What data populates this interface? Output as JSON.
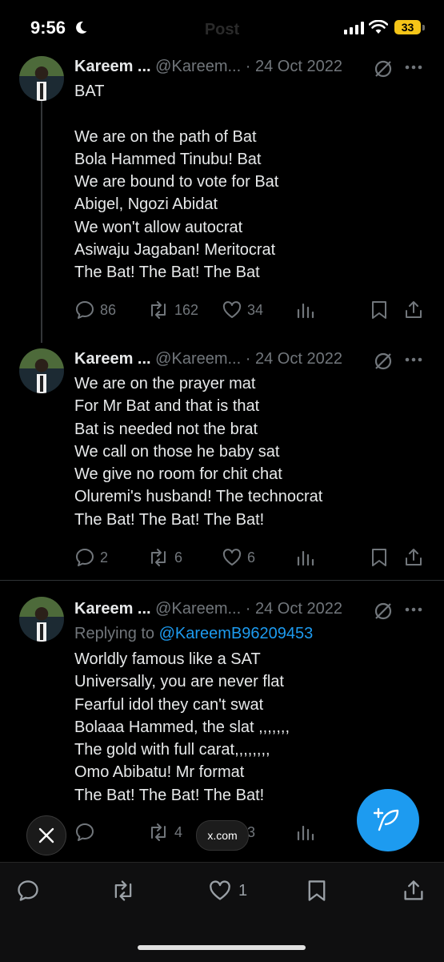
{
  "status_bar": {
    "time": "9:56",
    "battery": "33",
    "faded_title": "Post"
  },
  "tweets": [
    {
      "name": "Kareem ...",
      "handle": "@Kareem...",
      "sep": "·",
      "date": "24 Oct 2022",
      "body": "BAT\n\nWe are on the path of Bat\nBola Hammed Tinubu! Bat\nWe are bound to vote for Bat\nAbigel, Ngozi Abidat\nWe won't allow autocrat\nAsiwaju Jagaban! Meritocrat\nThe Bat! The Bat! The Bat",
      "replies": "86",
      "reposts": "162",
      "likes": "34"
    },
    {
      "name": "Kareem ...",
      "handle": "@Kareem...",
      "sep": "·",
      "date": "24 Oct 2022",
      "body": "We are on the prayer mat\nFor Mr Bat and that is that\nBat is needed not the brat\nWe call on those he baby sat\nWe give no room for chit chat\nOluremi's husband! The technocrat\nThe Bat! The Bat! The Bat!",
      "replies": "2",
      "reposts": "6",
      "likes": "6"
    },
    {
      "name": "Kareem ...",
      "handle": "@Kareem...",
      "sep": "·",
      "date": "24 Oct 2022",
      "reply_prefix": "Replying to ",
      "reply_mention": "@KareemB96209453",
      "body": "Worldly famous like a SAT\nUniversally, you are never flat\nFearful idol they can't swat\nBolaaa Hammed, the slat ,,,,,,,\nThe gold with full carat,,,,,,,,\nOmo Abibatu! Mr format\nThe Bat! The Bat! The Bat!",
      "reposts": "4",
      "likes": "3"
    }
  ],
  "overlay": {
    "url": "x.com"
  },
  "bottom_bar": {
    "likes": "1"
  },
  "colors": {
    "accent": "#1d9bf0",
    "muted": "#71767b",
    "text": "#e7e9ea",
    "background": "#000000"
  }
}
